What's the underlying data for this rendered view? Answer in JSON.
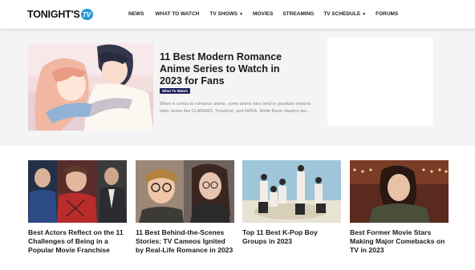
{
  "header": {
    "logo_text": "TONIGHT'S",
    "logo_tv": "TV",
    "nav": [
      {
        "label": "NEWS",
        "dropdown": false
      },
      {
        "label": "WHAT TO WATCH",
        "dropdown": false
      },
      {
        "label": "TV SHOWS",
        "dropdown": true
      },
      {
        "label": "MOVIES",
        "dropdown": false
      },
      {
        "label": "STREAMING",
        "dropdown": false
      },
      {
        "label": "TV SCHEDULE",
        "dropdown": true
      },
      {
        "label": "FORUMS",
        "dropdown": false
      }
    ]
  },
  "hero": {
    "title": "11 Best Modern Romance Anime Series to Watch in 2023 for Fans",
    "badge": "What To Watch",
    "excerpt": "When it comes to romance anime, some anime fans tend to gravitate towards older series like CLANNAD, Toradora!, and NANA. While these classics are..."
  },
  "cards": [
    {
      "title": "Best Actors Reflect on the 11 Challenges of Being in a Popular Movie Franchise"
    },
    {
      "title": "11 Best Behind-the-Scenes Stories: TV Cameos Ignited by Real-Life Romance in 2023"
    },
    {
      "title": "Top 11 Best K-Pop Boy Groups in 2023"
    },
    {
      "title": "Best Former Movie Stars Making Major Comebacks on TV in 2023"
    }
  ],
  "colors": {
    "accent": "#2b9ad6",
    "badge_bg": "#1c1f5a",
    "hero_bg": "#f4f4f4"
  }
}
